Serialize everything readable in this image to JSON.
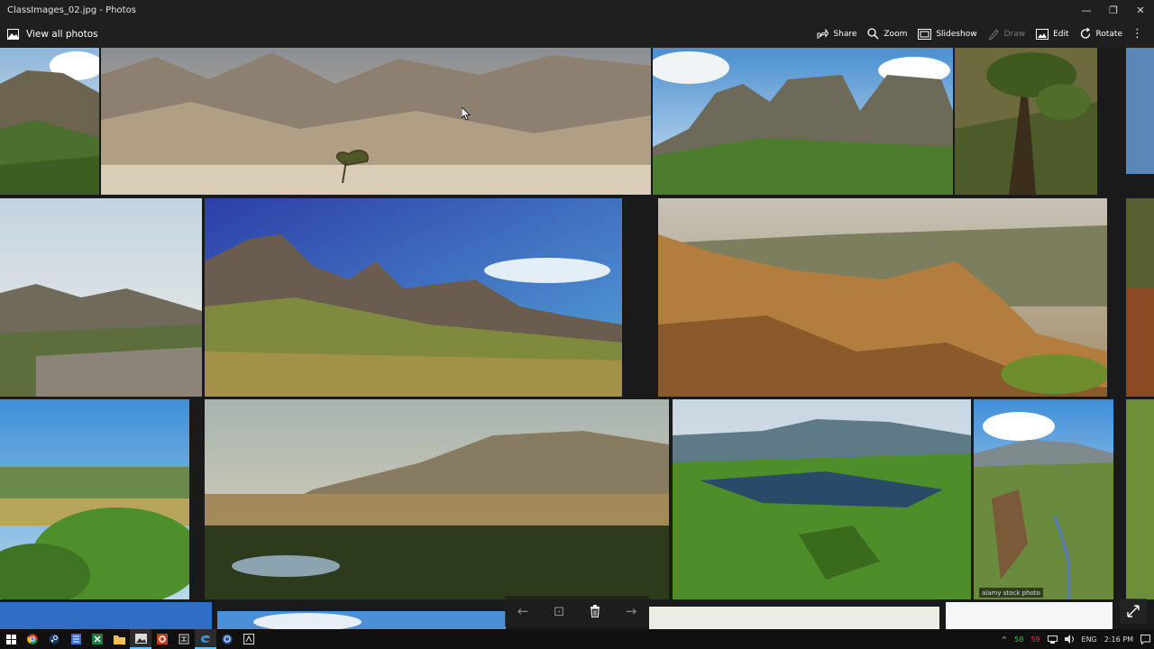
{
  "window": {
    "title": "ClassImages_02.jpg - Photos",
    "controls": [
      "—",
      "❐",
      "✕"
    ]
  },
  "toolbar": {
    "view_all_label": "View all photos",
    "actions": [
      {
        "label": "Share",
        "icon": "share-icon",
        "enabled": true
      },
      {
        "label": "Zoom",
        "icon": "zoom-icon",
        "enabled": true
      },
      {
        "label": "Slideshow",
        "icon": "slideshow-icon",
        "enabled": true
      },
      {
        "label": "Draw",
        "icon": "draw-icon",
        "enabled": false
      },
      {
        "label": "Edit",
        "icon": "edit-icon",
        "enabled": true
      },
      {
        "label": "Rotate",
        "icon": "rotate-icon",
        "enabled": true
      }
    ],
    "more_label": "⋮"
  },
  "image": {
    "description_tiles": [
      "cliffs",
      "desert-mountain",
      "twin-peaks",
      "tree-slope",
      "coastal-town",
      "blue-sky-peaks",
      "rocky-gorge",
      "green-valley",
      "lake-plateau",
      "green-canyon",
      "river-gorge"
    ],
    "watermark_text": "alamy stock photo"
  },
  "viewer_nav": {
    "prev": "←",
    "fit": "⊡",
    "delete": "🗑",
    "next": "→"
  },
  "taskbar": {
    "icons": [
      "windows-start-icon",
      "chrome-icon",
      "steam-icon",
      "notepad-icon",
      "excel-icon",
      "file-explorer-icon",
      "photos-icon",
      "powerpoint-icon",
      "app-icon",
      "edge-icon",
      "browser-icon",
      "capture-icon"
    ],
    "tray": {
      "chevron": "^",
      "num1": "58",
      "num2": "59",
      "lang": "ENG",
      "time": "2:16 PM"
    }
  },
  "colors": {
    "chrome_bg": "#1f1f1f",
    "taskbar_bg": "#101010",
    "accent": "#76b9ed",
    "tray_green": "#3fbf5a",
    "tray_red": "#d93b3b"
  }
}
